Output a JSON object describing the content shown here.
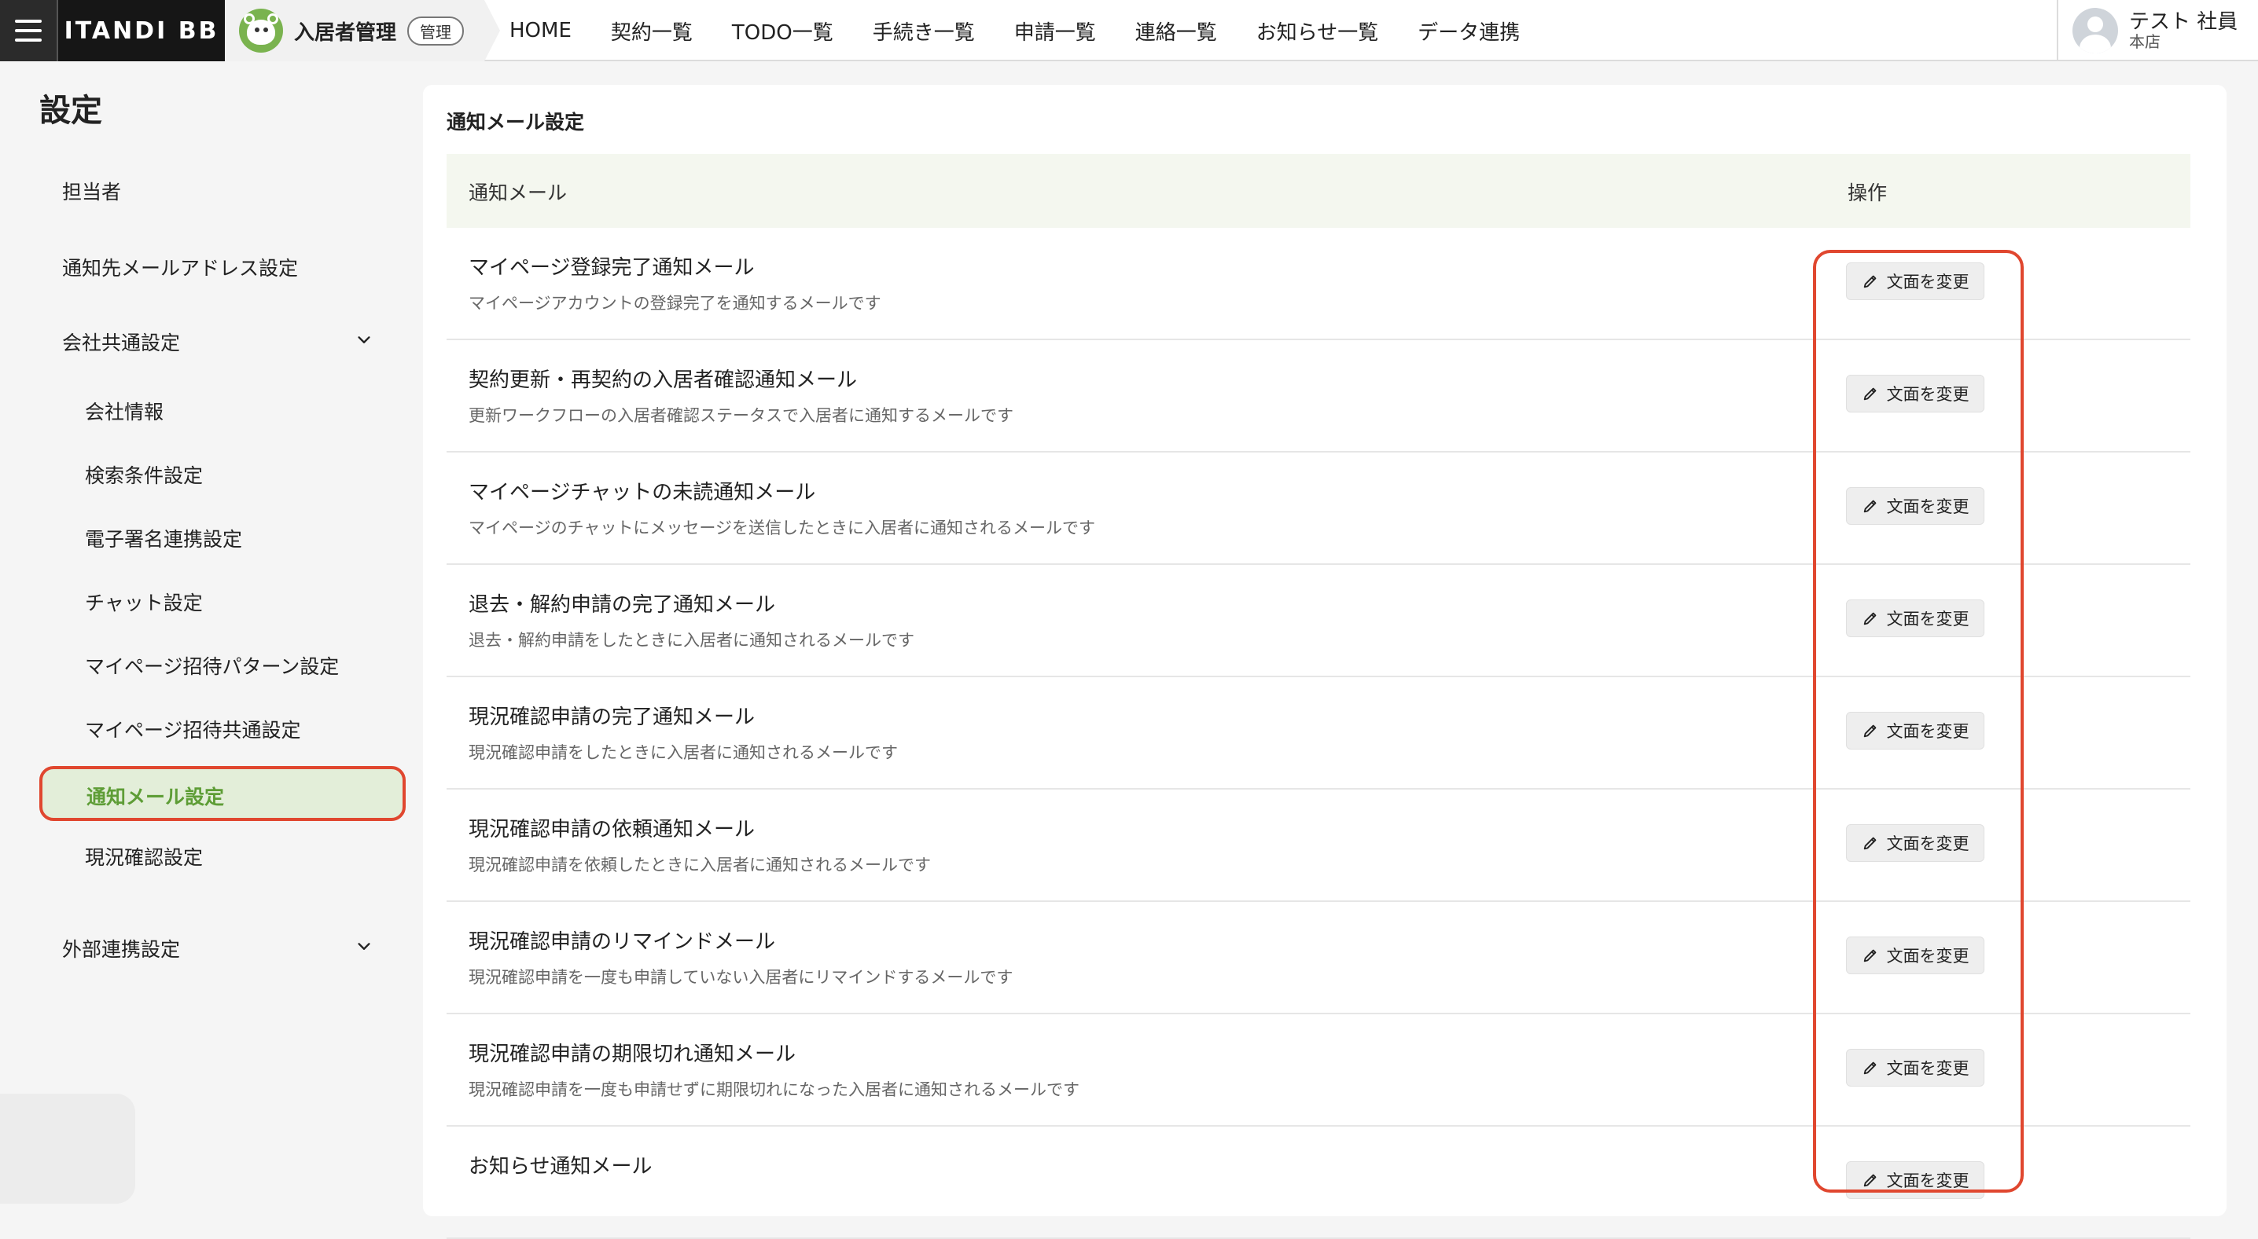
{
  "header": {
    "brand": "ITANDI BB",
    "product_name": "入居者管理",
    "product_badge": "管理",
    "nav": [
      "HOME",
      "契約一覧",
      "TODO一覧",
      "手続き一覧",
      "申請一覧",
      "連絡一覧",
      "お知らせ一覧",
      "データ連携"
    ],
    "user_name": "テスト 社員",
    "user_store": "本店"
  },
  "sidebar": {
    "title": "設定",
    "items": {
      "tantou": "担当者",
      "notify_address": "通知先メールアドレス設定",
      "company_common": "会社共通設定",
      "company_info": "会社情報",
      "search_condition": "検索条件設定",
      "esign": "電子署名連携設定",
      "chat": "チャット設定",
      "invite_pattern": "マイページ招待パターン設定",
      "invite_common": "マイページ招待共通設定",
      "notify_mail": "通知メール設定",
      "status_confirm": "現況確認設定",
      "external": "外部連携設定"
    }
  },
  "main": {
    "title": "通知メール設定",
    "columns": {
      "mail": "通知メール",
      "action": "操作"
    },
    "edit_label": "文面を変更",
    "rows": [
      {
        "title": "マイページ登録完了通知メール",
        "desc": "マイページアカウントの登録完了を通知するメールです"
      },
      {
        "title": "契約更新・再契約の入居者確認通知メール",
        "desc": "更新ワークフローの入居者確認ステータスで入居者に通知するメールです"
      },
      {
        "title": "マイページチャットの未読通知メール",
        "desc": "マイページのチャットにメッセージを送信したときに入居者に通知されるメールです"
      },
      {
        "title": "退去・解約申請の完了通知メール",
        "desc": "退去・解約申請をしたときに入居者に通知されるメールです"
      },
      {
        "title": "現況確認申請の完了通知メール",
        "desc": "現況確認申請をしたときに入居者に通知されるメールです"
      },
      {
        "title": "現況確認申請の依頼通知メール",
        "desc": "現況確認申請を依頼したときに入居者に通知されるメールです"
      },
      {
        "title": "現況確認申請のリマインドメール",
        "desc": "現況確認申請を一度も申請していない入居者にリマインドするメールです"
      },
      {
        "title": "現況確認申請の期限切れ通知メール",
        "desc": "現況確認申請を一度も申請せずに期限切れになった入居者に通知されるメールです"
      },
      {
        "title": "お知らせ通知メール",
        "desc": ""
      }
    ]
  },
  "colors": {
    "accent_green": "#5e9d36",
    "active_bg": "#e3eed9",
    "highlight_red": "#e0472f",
    "brand_dark": "#161616"
  },
  "icons": [
    "menu-icon",
    "mascot-logo",
    "user-avatar-icon",
    "chevron-down-icon",
    "pencil-icon"
  ]
}
